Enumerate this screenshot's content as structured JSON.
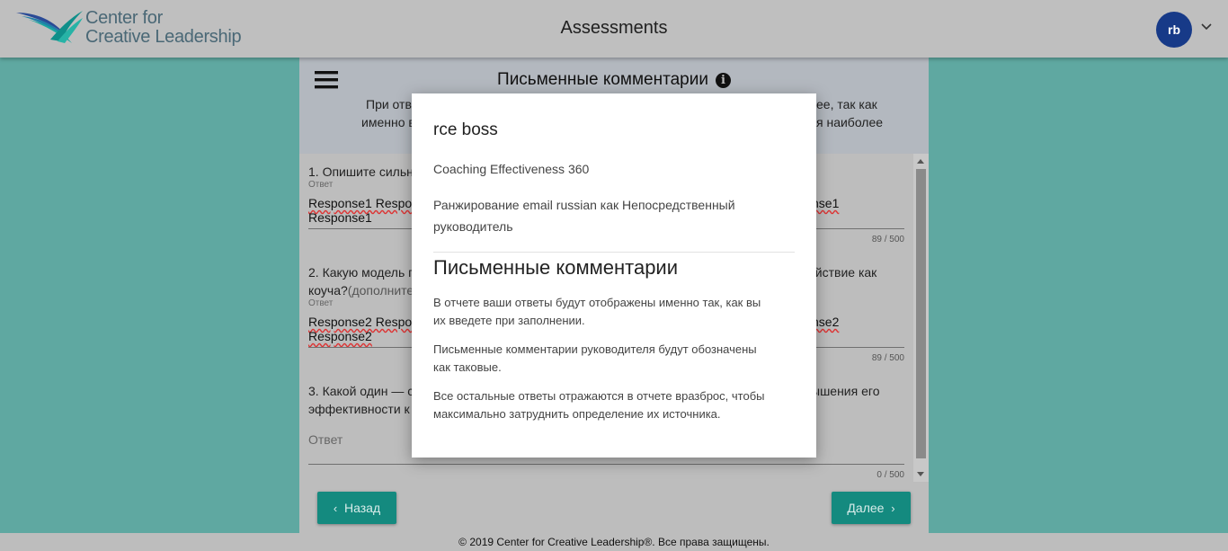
{
  "header": {
    "logo_line1": "Center for",
    "logo_line2": "Creative Leadership",
    "title": "Assessments",
    "user_initials": "rb"
  },
  "panel": {
    "title": "Письменные комментарии",
    "intro_left_1": "При отв",
    "intro_left_2": "именно в",
    "intro_right_1": "ее, так как",
    "intro_right_2": "я наиболее"
  },
  "questions": [
    {
      "prompt_left": "1. Опишите сильн",
      "answer_label": "Ответ",
      "response_left_1": "Response1 Respo",
      "response_right_1": "nse1",
      "response_line2": "Response1",
      "count": "89 / 500"
    },
    {
      "prompt_left_1": "2. Какую модель п",
      "prompt_right_1": "ействие как",
      "prompt_left_2a": "коуча?",
      "prompt_left_2b": "(дополните",
      "answer_label": "Ответ",
      "response_left_1": "Response2 Respo",
      "response_right_1": "nse2",
      "response_line2": "Response2",
      "count": "89 / 500"
    },
    {
      "prompt_left_1": "3. Какой один — с",
      "prompt_right_1": "ышения его",
      "prompt_left_2": "эффективности к",
      "placeholder": "Ответ",
      "count": "0 / 500"
    }
  ],
  "nav": {
    "back_label": "Назад",
    "next_label": "Далее"
  },
  "footer": {
    "text": "© 2019 Center for Creative Leadership®. Все права защищены."
  },
  "modal": {
    "name": "rce boss",
    "assessment": "Coaching Effectiveness 360",
    "role_line1": "Ранжирование email russian как Непосредственный",
    "role_line2": "руководитель",
    "section_title": "Письменные комментарии",
    "para1_line1": "В отчете ваши ответы будут отображены именно так, как вы",
    "para1_line2": "их введете при заполнении.",
    "para2_line1": "Письменные комментарии руководителя будут обозначены",
    "para2_line2": "как таковые.",
    "para3_line1": "Все остальные ответы отражаются в отчете вразброс, чтобы",
    "para3_line2": "максимально затруднить определение их источника."
  },
  "colors": {
    "background": "#5fa8a1",
    "header": "#bfbfbf",
    "button": "#148a7f",
    "avatar": "#173a88"
  }
}
